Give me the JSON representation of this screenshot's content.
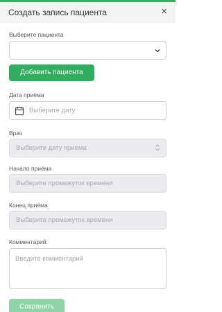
{
  "header": {
    "title": "Создать запись пациента",
    "close_glyph": "×"
  },
  "patient": {
    "label": "Выберите пациента",
    "value": ""
  },
  "add_button": {
    "label": "Добавить пациента"
  },
  "date": {
    "label": "Дата приёма",
    "placeholder": "Выберите дату"
  },
  "doctor": {
    "label": "Врач",
    "placeholder": "Выберите дату приема"
  },
  "start": {
    "label": "Начало приёма",
    "placeholder": "Выберите промежуток времени"
  },
  "end": {
    "label": "Конец приёма",
    "placeholder": "Выберите промежуток времени"
  },
  "comment": {
    "label": "Комментарий:",
    "placeholder": "Введите комментарий"
  },
  "save_button": {
    "label": "Сохранить"
  },
  "colors": {
    "accent": "#2fb463",
    "primary_button": "#2eae5e",
    "disabled_button": "#8fd3a9",
    "disabled_field": "#ececef"
  },
  "icons": [
    "close-icon",
    "chevron-down-icon",
    "calendar-icon",
    "up-down-arrows-icon"
  ]
}
